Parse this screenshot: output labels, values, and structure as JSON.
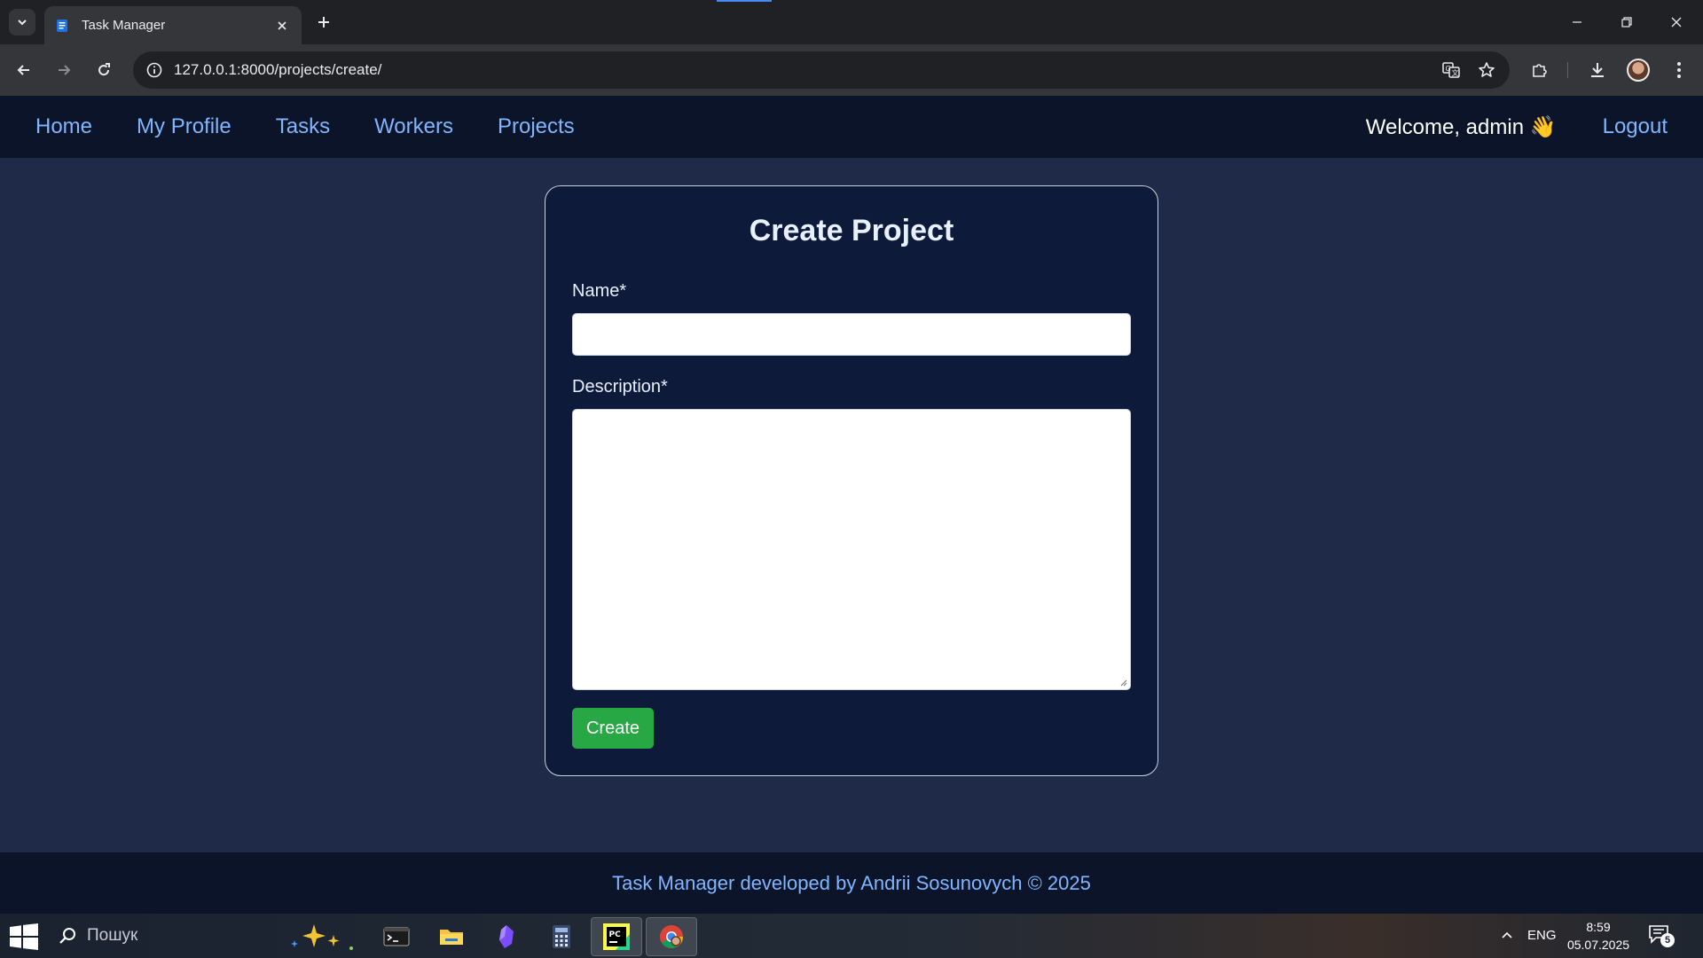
{
  "browser": {
    "tab_title": "Task Manager",
    "url": "127.0.0.1:8000/projects/create/"
  },
  "navbar": {
    "links": [
      "Home",
      "My Profile",
      "Tasks",
      "Workers",
      "Projects"
    ],
    "welcome": "Welcome, admin 👋",
    "logout": "Logout"
  },
  "form": {
    "title": "Create Project",
    "name_label": "Name*",
    "name_value": "",
    "description_label": "Description*",
    "description_value": "",
    "submit_label": "Create"
  },
  "footer": {
    "text": "Task Manager developed by Andrii Sosunovych © 2025"
  },
  "taskbar": {
    "search_placeholder": "Пошук",
    "language": "ENG",
    "time": "8:59",
    "date": "05.07.2025",
    "notification_count": "5",
    "apps": [
      "terminal-icon",
      "file-explorer-icon",
      "obsidian-icon",
      "calculator-icon",
      "pycharm-icon",
      "chrome-icon"
    ],
    "active_apps": [
      "pycharm-icon",
      "chrome-icon"
    ]
  },
  "colors": {
    "page_bg": "#1e2a47",
    "navbar_bg": "#0b1428",
    "card_bg": "#0e1a3a",
    "link": "#7fb6ff",
    "button_green": "#28a745"
  }
}
